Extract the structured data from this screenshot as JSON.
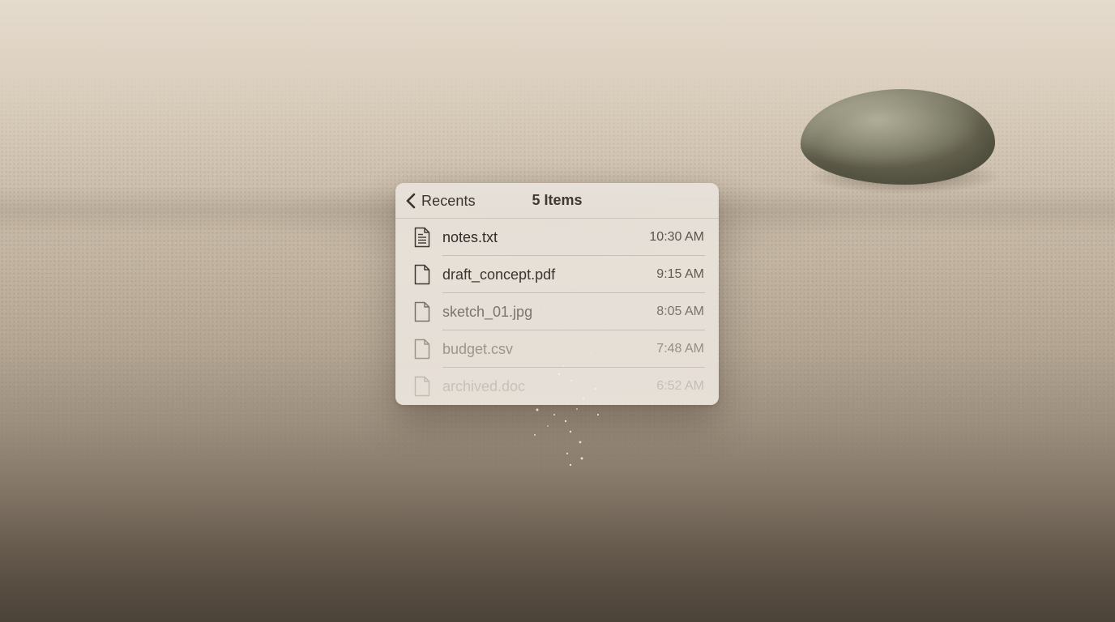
{
  "panel": {
    "back_label": "Recents",
    "title": "5 Items",
    "items": [
      {
        "name": "notes.txt",
        "time": "10:30 AM",
        "icon": "text-document-icon"
      },
      {
        "name": "draft_concept.pdf",
        "time": "9:15 AM",
        "icon": "document-icon"
      },
      {
        "name": "sketch_01.jpg",
        "time": "8:05 AM",
        "icon": "document-icon"
      },
      {
        "name": "budget.csv",
        "time": "7:48 AM",
        "icon": "document-icon"
      },
      {
        "name": "archived.doc",
        "time": "6:52 AM",
        "icon": "document-icon"
      }
    ]
  },
  "colors": {
    "panel_background": "#e9e3db",
    "text_primary": "#2f2b27",
    "text_secondary": "#5a544c"
  }
}
